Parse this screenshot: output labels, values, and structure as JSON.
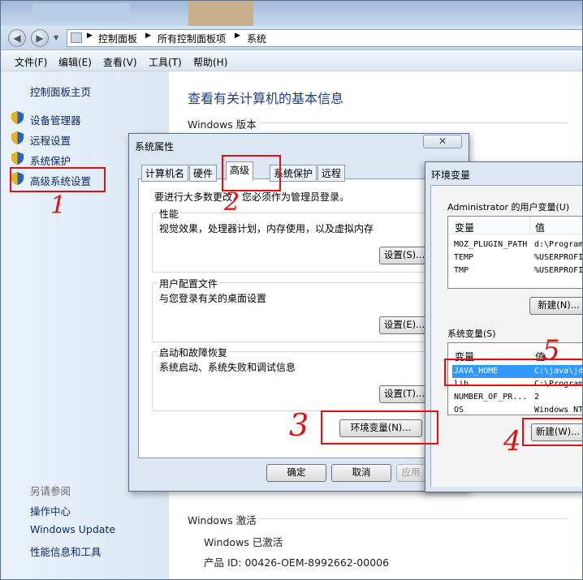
{
  "breadcrumb": [
    "控制面板",
    "所有控制面板项",
    "系统"
  ],
  "menubar": [
    "文件(F)",
    "编辑(E)",
    "查看(V)",
    "工具(T)",
    "帮助(H)"
  ],
  "left_pane": {
    "home": "控制面板主页",
    "links": [
      "设备管理器",
      "远程设置",
      "系统保护",
      "高级系统设置"
    ],
    "see_also_title": "另请参阅",
    "see_also": [
      "操作中心",
      "Windows Update",
      "性能信息和工具"
    ]
  },
  "main": {
    "title": "查看有关计算机的基本信息",
    "windows_edition": "Windows 版本",
    "activation_title": "Windows 激活",
    "activated": "Windows 已激活",
    "product_id": "产品 ID: 00426-OEM-8992662-00006"
  },
  "sysprop": {
    "title": "系统属性",
    "tabs": [
      "计算机名",
      "硬件",
      "高级",
      "系统保护",
      "远程"
    ],
    "admin_note": "要进行大多数更改，您必须作为管理员登录。",
    "groups": [
      {
        "title": "性能",
        "desc": "视觉效果，处理器计划，内存使用，以及虚拟内存",
        "button": "设置(S)..."
      },
      {
        "title": "用户配置文件",
        "desc": "与您登录有关的桌面设置",
        "button": "设置(E)..."
      },
      {
        "title": "启动和故障恢复",
        "desc": "系统启动、系统失败和调试信息",
        "button": "设置(T)..."
      }
    ],
    "env_button": "环境变量(N)...",
    "ok": "确定",
    "cancel": "取消",
    "apply": "应用",
    "close_glyph": "✕"
  },
  "envvars": {
    "title": "环境变量",
    "user_section": "Administrator 的用户变量(U)",
    "col_var": "变量",
    "col_val": "值",
    "user_vars": [
      {
        "name": "MOZ_PLUGIN_PATH",
        "value": "d:\\Program"
      },
      {
        "name": "TEMP",
        "value": "%USERPROFI"
      },
      {
        "name": "TMP",
        "value": "%USERPROFI"
      }
    ],
    "user_new": "新建(N)...",
    "system_section": "系统变量(S)",
    "system_vars": [
      {
        "name": "JAVA_HOME",
        "value": "C:\\java\\jd"
      },
      {
        "name": "lib",
        "value": "C:\\Program"
      },
      {
        "name": "NUMBER_OF_PR...",
        "value": "2"
      },
      {
        "name": "OS",
        "value": "Windows_NT"
      }
    ],
    "system_new": "新建(W)..."
  },
  "annotations": [
    "1",
    "2",
    "3",
    "4",
    "5"
  ],
  "colors": {
    "annotation": "#e01010",
    "selection": "#3399ff",
    "link": "#0f2d6b"
  }
}
